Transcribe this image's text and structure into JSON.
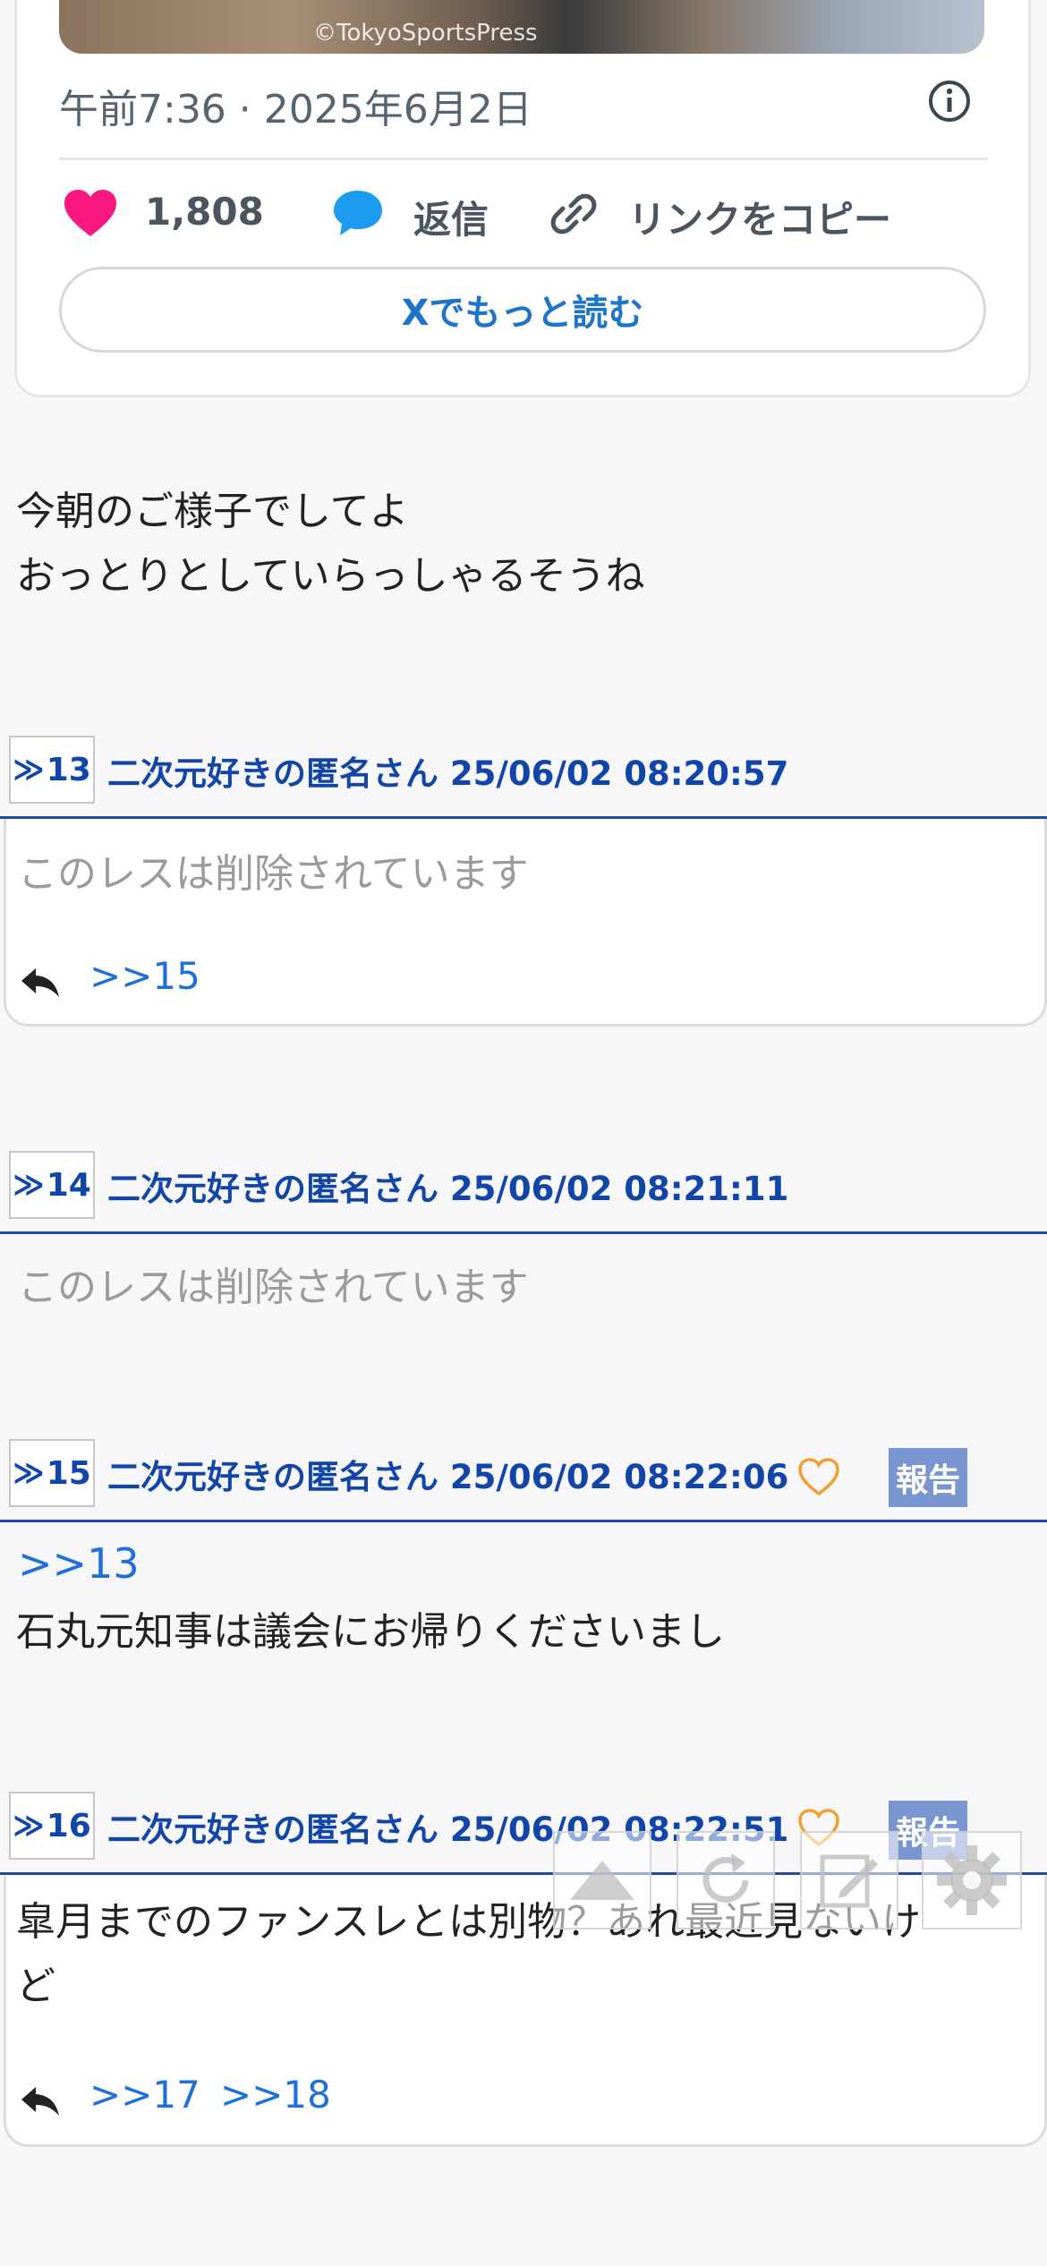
{
  "embed": {
    "image_credit": "©TokyoSportsPress",
    "timestamp": "午前7:36 · 2025年6月2日",
    "likes": "1,808",
    "reply_label": "返信",
    "copy_link_label": "リンクをコピー",
    "read_more_label": "Xでもっと読む"
  },
  "post12": {
    "lines": [
      "今朝のご様子でしてよ",
      "おっとりとしていらっしゃるそうね"
    ]
  },
  "posts": [
    {
      "num": "13",
      "meta": "二次元好きの匿名さん 25/06/02 08:20:57",
      "body": "このレスは削除されています",
      "replies": [
        ">>15"
      ]
    },
    {
      "num": "14",
      "meta": "二次元好きの匿名さん 25/06/02 08:21:11",
      "body": "このレスは削除されています"
    },
    {
      "num": "15",
      "meta": "二次元好きの匿名さん 25/06/02 08:22:06",
      "report": "報告",
      "anchor": ">>13",
      "body": "石丸元知事は議会にお帰りくださいまし"
    },
    {
      "num": "16",
      "meta": "二次元好きの匿名さん 25/06/02 08:22:51",
      "report": "報告",
      "body_lines": [
        "皐月までのファンスレとは別物？あれ最近見ないけ",
        "ど"
      ],
      "replies": [
        ">>17",
        ">>18"
      ]
    }
  ],
  "colors": {
    "link": "#1e6fd9",
    "header": "#1146a8",
    "report_bg": "#7a96d0",
    "like": "#f91880",
    "reply": "#1d9bf0",
    "heart_outline": "#f0a030"
  },
  "icons": [
    "info-icon",
    "heart-icon",
    "speech-bubble-icon",
    "link-icon",
    "reply-arrow-icon",
    "heart-outline-icon",
    "scroll-top-icon",
    "reload-icon",
    "compose-icon",
    "gear-icon"
  ]
}
